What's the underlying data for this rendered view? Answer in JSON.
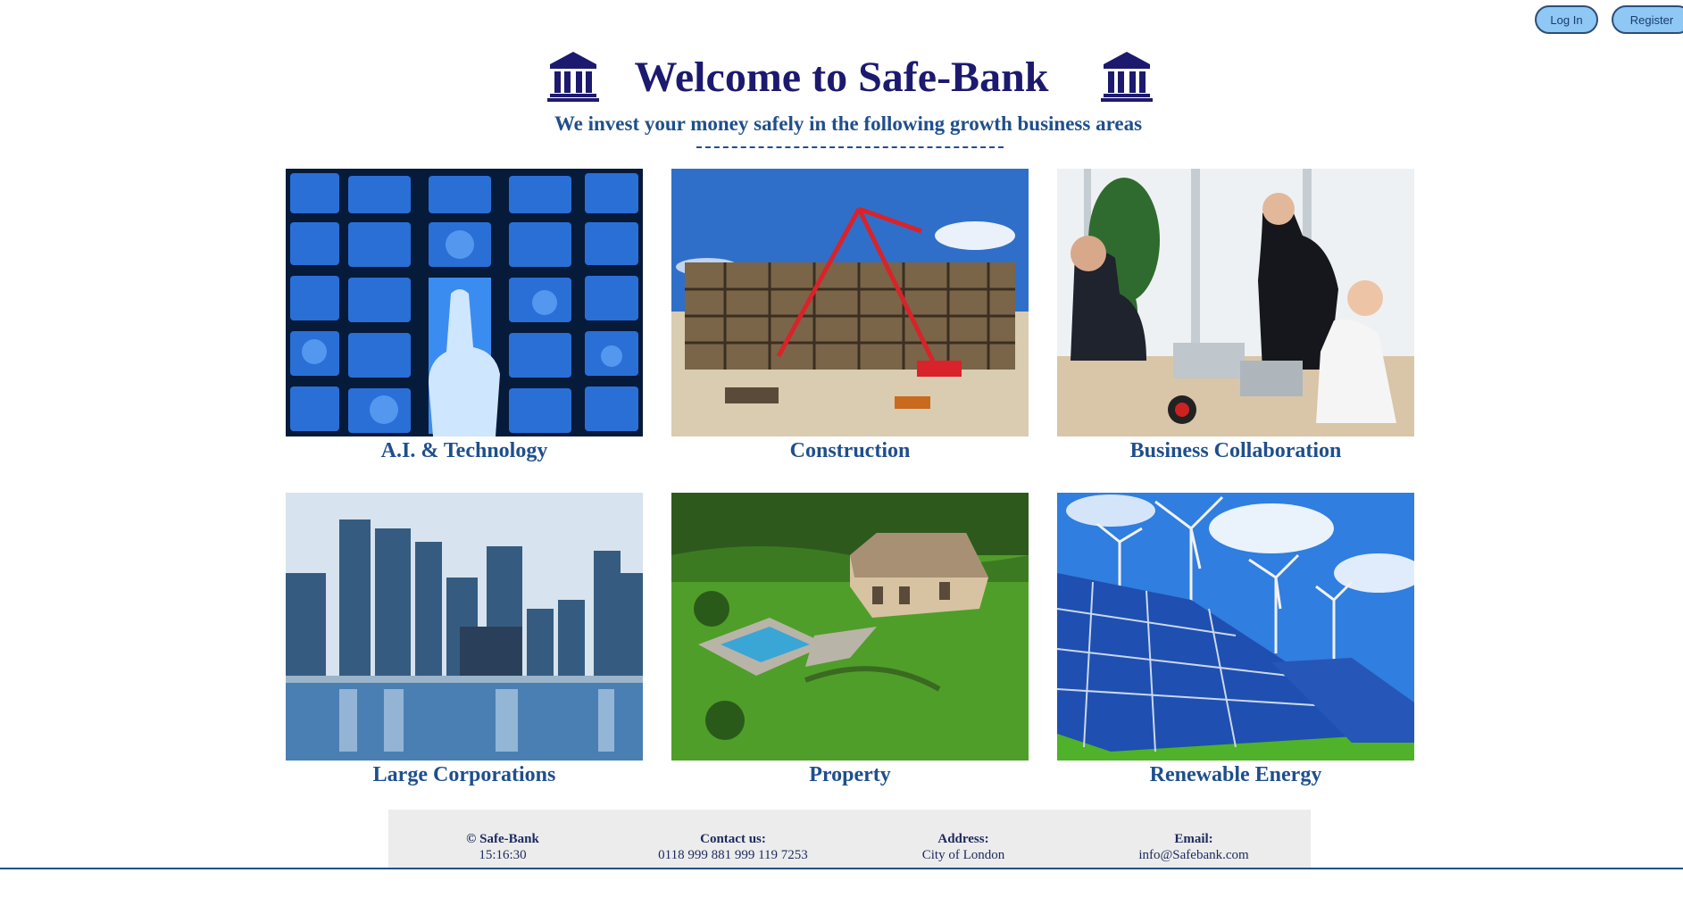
{
  "auth": {
    "login_label": "Log In",
    "register_label": "Register"
  },
  "header": {
    "title": "Welcome to Safe-Bank",
    "subtitle": "We invest your money safely in the following growth business areas"
  },
  "tiles": [
    {
      "label": "A.I. & Technology",
      "icon": "ai-technology-image"
    },
    {
      "label": "Construction",
      "icon": "construction-site-image"
    },
    {
      "label": "Business Collaboration",
      "icon": "business-meeting-image"
    },
    {
      "label": "Large Corporations",
      "icon": "city-skyline-image"
    },
    {
      "label": "Property",
      "icon": "house-property-image"
    },
    {
      "label": "Renewable Energy",
      "icon": "solar-wind-image"
    }
  ],
  "footer": {
    "copyright": "© Safe-Bank",
    "time": "15:16:30",
    "contact_heading": "Contact us:",
    "contact_value": "0118 999 881 999 119 7253",
    "address_heading": "Address:",
    "address_value": "City of London",
    "email_heading": "Email:",
    "email_value": "info@Safebank.com"
  },
  "colors": {
    "title": "#1c1a6e",
    "accent": "#1f4f8c",
    "button": "#8fc7f5",
    "footer_bg": "#ececec"
  }
}
